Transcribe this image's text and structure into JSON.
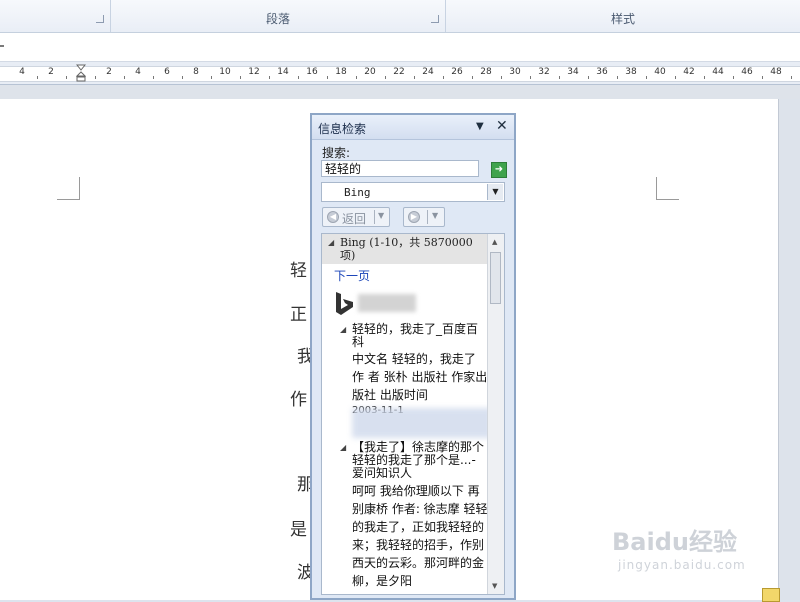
{
  "ribbon": {
    "paragraph_label": "段落",
    "styles_label": "样式"
  },
  "ruler": {
    "ticks": [
      "4",
      "2",
      "",
      "2",
      "4",
      "6",
      "8",
      "10",
      "12",
      "14",
      "16",
      "18",
      "20",
      "22",
      "24",
      "26",
      "28",
      "30",
      "32",
      "34",
      "36",
      "38",
      "40",
      "42",
      "44",
      "46",
      "48"
    ]
  },
  "document": {
    "visible_chars": [
      "轻",
      "正",
      "我",
      "作",
      "那",
      "是",
      "波"
    ]
  },
  "research_pane": {
    "title": "信息检索",
    "menu_icon": "dropdown-triangle-icon",
    "close_label": "✕",
    "search_label": "搜索:",
    "search_value": "轻轻的",
    "go_icon": "go-arrow-icon",
    "source_selected": "Bing",
    "back_label": "返回",
    "results": {
      "header": "Bing (1-10，共 5870000 项)",
      "next_page": "下一页",
      "item1_title": "轻轻的，我走了_百度百科",
      "item1_body": "中文名 轻轻的，我走了 作 者 张朴 出版社 作家出版社 出版时间",
      "item1_date": "2003-11-1",
      "item2_title": "【我走了】徐志摩的那个轻轻的我走了那个是...- 爱问知识人",
      "item2_body": "呵呵 我给你理顺以下 再别康桥 作者: 徐志摩 轻轻的我走了，正如我轻轻的来；我轻轻的招手，作别西天的云彩。那河畔的金柳，是夕阳"
    }
  },
  "watermark": {
    "text": "Baidu经验",
    "sub": "jingyan.baidu.com"
  }
}
